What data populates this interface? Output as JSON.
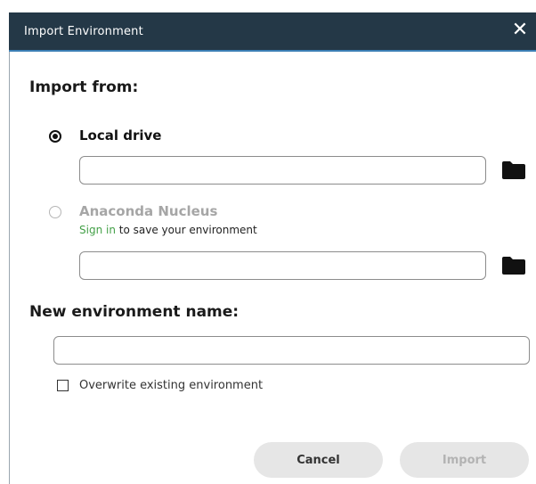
{
  "dialog": {
    "title": "Import Environment",
    "close_glyph": "✕"
  },
  "import_from": {
    "heading": "Import from:",
    "local_drive": {
      "label": "Local drive",
      "selected": true,
      "value": "",
      "placeholder": ""
    },
    "nucleus": {
      "label": "Anaconda Nucleus",
      "selected": false,
      "sign_in_link": "Sign in",
      "sign_in_suffix": " to save your environment",
      "value": "",
      "placeholder": ""
    }
  },
  "new_env": {
    "heading": "New environment name:",
    "value": "",
    "placeholder": "",
    "overwrite_label": "Overwrite existing environment",
    "overwrite_checked": false
  },
  "buttons": {
    "cancel": "Cancel",
    "import": "Import"
  },
  "colors": {
    "titlebar": "#243847",
    "accent_link": "#43a047",
    "disabled_text": "#b3b3b3"
  }
}
